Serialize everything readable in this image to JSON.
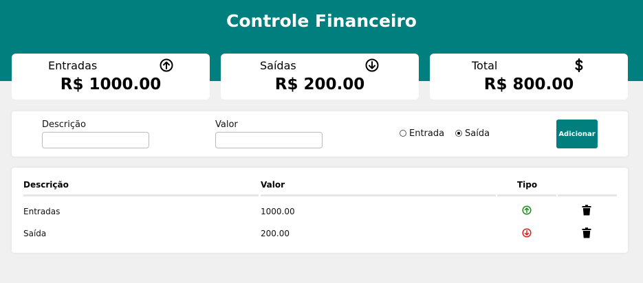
{
  "header": {
    "title": "Controle Financeiro",
    "color": "#007f7f"
  },
  "summary": {
    "entradas": {
      "label": "Entradas",
      "value": "R$ 1000.00",
      "icon": "arrow-up-circle-icon"
    },
    "saidas": {
      "label": "Saídas",
      "value": "R$ 200.00",
      "icon": "arrow-down-circle-icon"
    },
    "total": {
      "label": "Total",
      "value": "R$ 800.00",
      "icon": "dollar-icon"
    }
  },
  "form": {
    "descricao_label": "Descrição",
    "descricao_value": "",
    "valor_label": "Valor",
    "valor_value": "",
    "tipo_options": [
      "Entrada",
      "Saída"
    ],
    "tipo_selected": "Saída",
    "add_button": "Adicionar"
  },
  "table": {
    "headers": {
      "descricao": "Descrição",
      "valor": "Valor",
      "tipo": "Tipo"
    },
    "rows": [
      {
        "descricao": "Entradas",
        "valor": "1000.00",
        "tipo": "entrada",
        "tipo_icon": "arrow-up-circle-icon",
        "tipo_color": "#1a8c1a"
      },
      {
        "descricao": "Saída",
        "valor": "200.00",
        "tipo": "saida",
        "tipo_icon": "arrow-down-circle-icon",
        "tipo_color": "#e01b1b"
      }
    ]
  }
}
